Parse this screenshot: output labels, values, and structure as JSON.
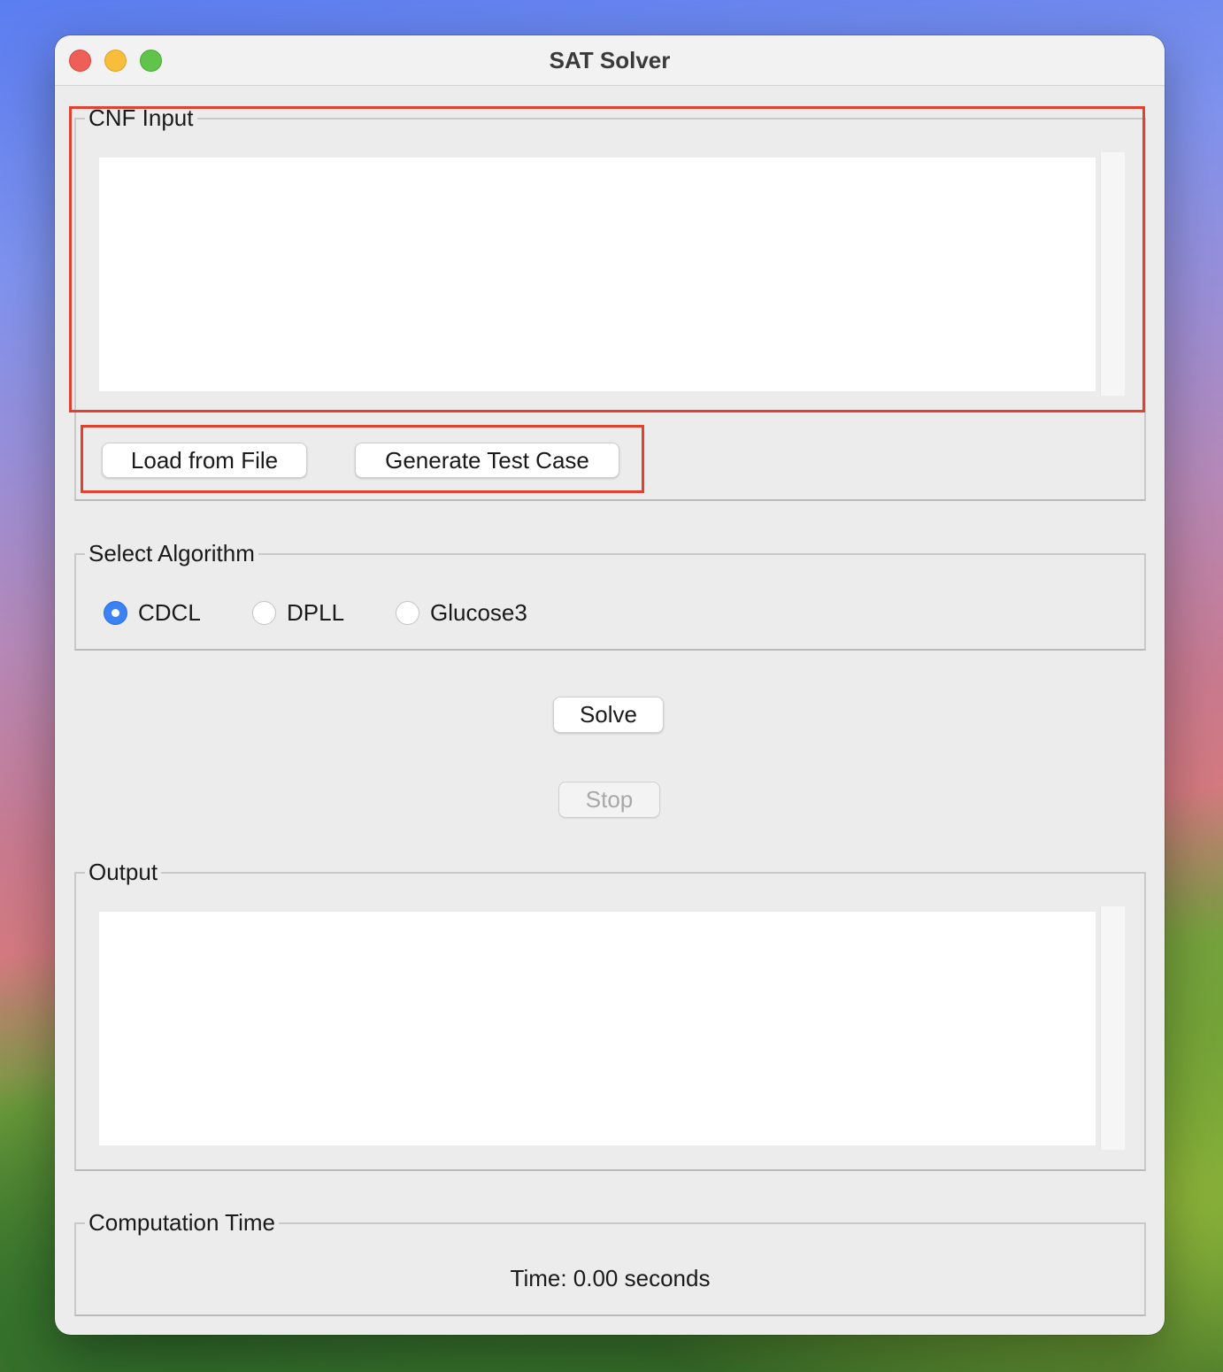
{
  "window": {
    "title": "SAT Solver"
  },
  "cnf_input": {
    "group_label": "CNF Input",
    "value": "",
    "buttons": {
      "load_from_file": "Load from File",
      "generate_test_case": "Generate Test Case"
    }
  },
  "algorithm": {
    "group_label": "Select Algorithm",
    "options": [
      {
        "label": "CDCL",
        "selected": true
      },
      {
        "label": "DPLL",
        "selected": false
      },
      {
        "label": "Glucose3",
        "selected": false
      }
    ]
  },
  "actions": {
    "solve": "Solve",
    "stop": "Stop",
    "stop_enabled": false
  },
  "output": {
    "group_label": "Output",
    "value": ""
  },
  "computation_time": {
    "group_label": "Computation Time",
    "text": "Time: 0.00 seconds"
  },
  "colors": {
    "highlight": "#e2412f",
    "radio_selected": "#3b82f6"
  }
}
